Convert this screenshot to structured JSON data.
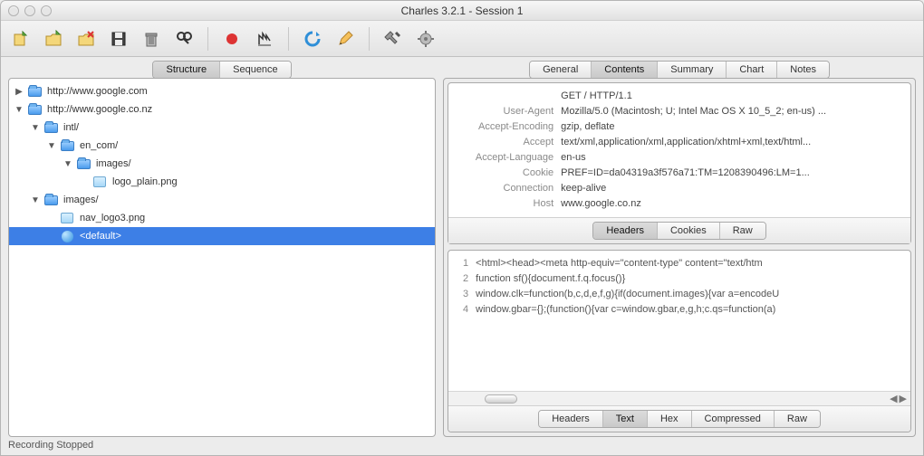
{
  "window": {
    "title": "Charles 3.2.1 - Session 1"
  },
  "left_tabs": {
    "structure": "Structure",
    "sequence": "Sequence"
  },
  "tree": [
    {
      "depth": 0,
      "arrow": "▶",
      "icon": "folder",
      "label": "http://www.google.com"
    },
    {
      "depth": 0,
      "arrow": "▼",
      "icon": "folder",
      "label": "http://www.google.co.nz"
    },
    {
      "depth": 1,
      "arrow": "▼",
      "icon": "folder",
      "label": "intl/"
    },
    {
      "depth": 2,
      "arrow": "▼",
      "icon": "folder",
      "label": "en_com/"
    },
    {
      "depth": 3,
      "arrow": "▼",
      "icon": "folder",
      "label": "images/"
    },
    {
      "depth": 4,
      "arrow": "",
      "icon": "img",
      "label": "logo_plain.png"
    },
    {
      "depth": 1,
      "arrow": "▼",
      "icon": "folder",
      "label": "images/"
    },
    {
      "depth": 2,
      "arrow": "",
      "icon": "img",
      "label": "nav_logo3.png"
    },
    {
      "depth": 2,
      "arrow": "",
      "icon": "globe",
      "label": "<default>",
      "selected": true
    }
  ],
  "right_tabs": {
    "general": "General",
    "contents": "Contents",
    "summary": "Summary",
    "chart": "Chart",
    "notes": "Notes"
  },
  "request": {
    "line": "GET / HTTP/1.1",
    "headers": [
      {
        "k": "User-Agent",
        "v": "Mozilla/5.0 (Macintosh; U; Intel Mac OS X 10_5_2; en-us) ..."
      },
      {
        "k": "Accept-Encoding",
        "v": "gzip, deflate"
      },
      {
        "k": "Accept",
        "v": "text/xml,application/xml,application/xhtml+xml,text/html..."
      },
      {
        "k": "Accept-Language",
        "v": "en-us"
      },
      {
        "k": "Cookie",
        "v": "PREF=ID=da04319a3f576a71:TM=1208390496:LM=1..."
      },
      {
        "k": "Connection",
        "v": "keep-alive"
      },
      {
        "k": "Host",
        "v": "www.google.co.nz"
      }
    ]
  },
  "req_tabs": {
    "headers": "Headers",
    "cookies": "Cookies",
    "raw": "Raw"
  },
  "body_lines": [
    "<html><head><meta http-equiv=\"content-type\" content=\"text/htm",
    "function sf(){document.f.q.focus()}",
    "window.clk=function(b,c,d,e,f,g){if(document.images){var a=encodeU",
    "window.gbar={};(function(){var c=window.gbar,e,g,h;c.qs=function(a)"
  ],
  "body_tabs": {
    "headers": "Headers",
    "text": "Text",
    "hex": "Hex",
    "compressed": "Compressed",
    "raw": "Raw"
  },
  "status": "Recording Stopped"
}
